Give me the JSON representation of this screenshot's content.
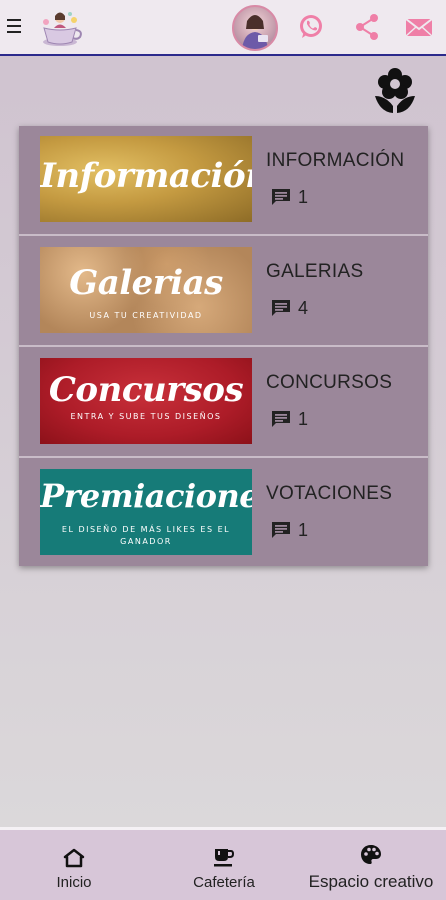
{
  "topbar": {
    "icons": [
      "menu-icon",
      "cup-logo-icon",
      "profile-avatar",
      "whatsapp-icon",
      "share-icon",
      "mail-icon"
    ],
    "accent": "#ef7fa7"
  },
  "header_icon": "flower-icon",
  "sections": [
    {
      "banner_title": "Información",
      "banner_subtitle": "",
      "title": "INFORMACIÓN",
      "count": "1",
      "color": "#b58f3c"
    },
    {
      "banner_title": "Galerias",
      "banner_subtitle": "USA TU CREATIVIDAD",
      "title": "GALERIAS",
      "count": "4",
      "color": "#b98a5a"
    },
    {
      "banner_title": "Concursos",
      "banner_subtitle": "ENTRA Y SUBE TUS DISEÑOS",
      "title": "CONCURSOS",
      "count": "1",
      "color": "#b81f2c"
    },
    {
      "banner_title": "Premiaciones",
      "banner_subtitle_line1": "EL DISEÑO DE MÁS LIKES ES EL",
      "banner_subtitle_line2": "GANADOR",
      "title": "VOTACIONES",
      "count": "1",
      "color": "#167b78"
    }
  ],
  "bottom_nav": [
    {
      "label": "Inicio",
      "icon": "home-icon"
    },
    {
      "label": "Cafetería",
      "icon": "coffee-icon"
    },
    {
      "label": "Espacio creativo",
      "icon": "palette-icon"
    }
  ]
}
